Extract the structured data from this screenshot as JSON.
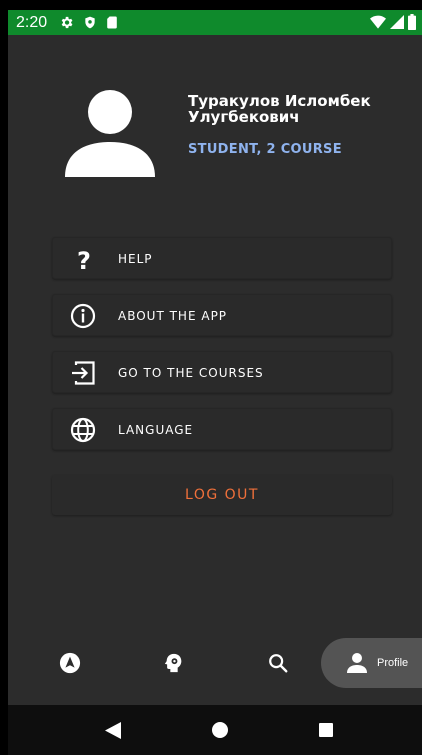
{
  "status_bar": {
    "time": "2:20",
    "icons": [
      "settings-icon",
      "shield-icon",
      "sd-card-icon",
      "wifi-icon",
      "signal-icon",
      "battery-icon"
    ],
    "background": "#0f8a2c"
  },
  "profile": {
    "name": "Туракулов Исломбек Улугбекович",
    "status": "STUDENT, 2 COURSE",
    "status_color": "#8fb3ee"
  },
  "menu": {
    "items": [
      {
        "label": "HELP",
        "icon": "question-icon"
      },
      {
        "label": "ABOUT THE APP",
        "icon": "info-icon"
      },
      {
        "label": "GO TO THE COURSES",
        "icon": "login-icon"
      },
      {
        "label": "LANGUAGE",
        "icon": "globe-icon"
      }
    ],
    "logout_label": "LOG OUT",
    "logout_color": "#f0703a"
  },
  "bottom_nav": {
    "items": [
      {
        "icon": "navigation-icon"
      },
      {
        "icon": "brain-icon"
      },
      {
        "icon": "search-icon"
      },
      {
        "icon": "person-icon",
        "label": "Profile",
        "selected": true
      }
    ]
  },
  "system_nav": {
    "icons": [
      "back-icon",
      "home-icon",
      "recents-icon"
    ]
  }
}
